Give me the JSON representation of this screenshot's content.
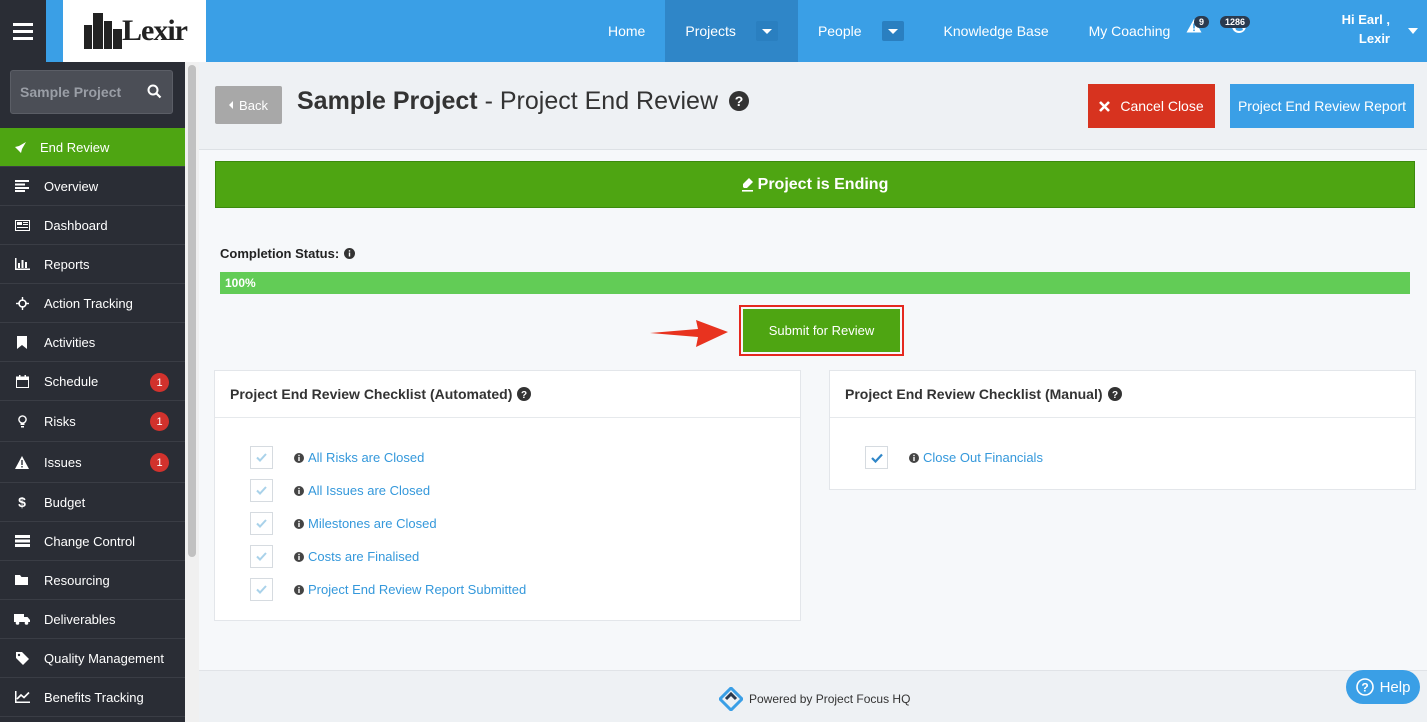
{
  "topbar": {
    "logo_text": "Lexir",
    "nav": [
      {
        "label": "Home"
      },
      {
        "label": "Projects"
      },
      {
        "label": "People"
      },
      {
        "label": "Knowledge Base"
      },
      {
        "label": "My Coaching"
      }
    ],
    "alerts_count": "9",
    "updates_count": "1286",
    "user_greeting": "Hi Earl ,",
    "user_org": "Lexir"
  },
  "sidebar": {
    "search_placeholder": "Sample Project",
    "items": [
      {
        "label": "End Review",
        "icon": "rocket-icon",
        "active": true
      },
      {
        "label": "Overview",
        "icon": "list-icon"
      },
      {
        "label": "Dashboard",
        "icon": "dashboard-icon"
      },
      {
        "label": "Reports",
        "icon": "bar-chart-icon"
      },
      {
        "label": "Action Tracking",
        "icon": "crosshair-icon"
      },
      {
        "label": "Activities",
        "icon": "bookmark-icon"
      },
      {
        "label": "Schedule",
        "icon": "calendar-icon",
        "count": "1"
      },
      {
        "label": "Risks",
        "icon": "lightbulb-icon",
        "count": "1"
      },
      {
        "label": "Issues",
        "icon": "warning-icon",
        "count": "1"
      },
      {
        "label": "Budget",
        "icon": "dollar-icon"
      },
      {
        "label": "Change Control",
        "icon": "change-icon"
      },
      {
        "label": "Resourcing",
        "icon": "folder-icon"
      },
      {
        "label": "Deliverables",
        "icon": "truck-icon"
      },
      {
        "label": "Quality Management",
        "icon": "tag-icon"
      },
      {
        "label": "Benefits Tracking",
        "icon": "line-chart-icon"
      }
    ]
  },
  "header": {
    "back_label": "Back",
    "project_name": "Sample Project",
    "title_separator": " - ",
    "page_name": "Project End Review",
    "cancel_label": "Cancel Close",
    "report_label": "Project End Review Report"
  },
  "status": {
    "banner": "Project is Ending",
    "completion_label": "Completion Status:",
    "progress_percent": 100,
    "progress_text": "100%",
    "submit_label": "Submit for Review"
  },
  "checklists": {
    "automated": {
      "title": "Project End Review Checklist (Automated)",
      "items": [
        {
          "label": "All Risks are Closed",
          "checked": true
        },
        {
          "label": "All Issues are Closed",
          "checked": true
        },
        {
          "label": "Milestones are Closed",
          "checked": true
        },
        {
          "label": "Costs are Finalised",
          "checked": true
        },
        {
          "label": "Project End Review Report Submitted",
          "checked": true
        }
      ]
    },
    "manual": {
      "title": "Project End Review Checklist (Manual)",
      "items": [
        {
          "label": "Close Out Financials",
          "checked": true
        }
      ]
    }
  },
  "footer": {
    "text": "Powered by Project Focus HQ",
    "help_label": "Help"
  },
  "colors": {
    "primary": "#3a9fe6",
    "success": "#4ea512",
    "danger": "#d7331f",
    "sidebar": "#2a2d35"
  }
}
